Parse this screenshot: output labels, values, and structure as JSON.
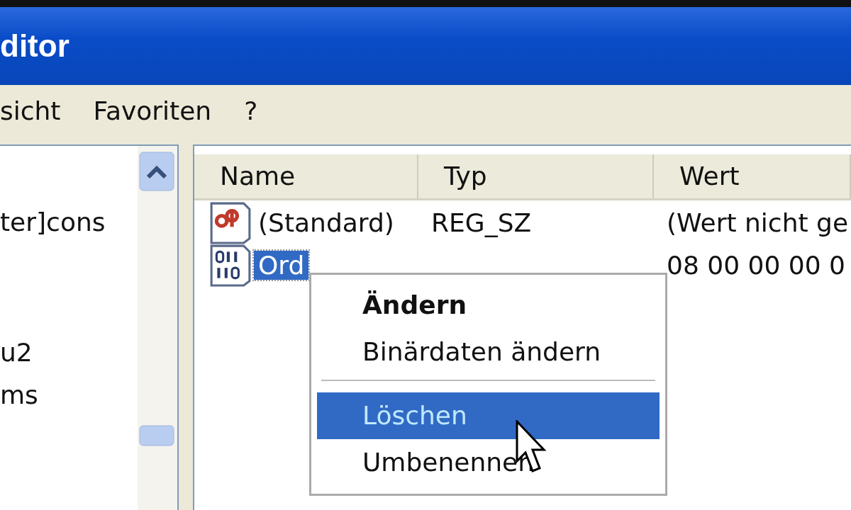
{
  "window": {
    "title": "ditor"
  },
  "menu_bar": [
    {
      "label": "sicht"
    },
    {
      "label": "Favoriten"
    },
    {
      "label": "?"
    }
  ],
  "tree": {
    "items": [
      {
        "label": "ter]cons"
      },
      {
        "label": "u2"
      },
      {
        "label": "ms"
      }
    ]
  },
  "table": {
    "columns": [
      "Name",
      "Typ",
      "Wert"
    ],
    "rows": [
      {
        "kind": "string",
        "name": "(Standard)",
        "type": "REG_SZ",
        "value": "(Wert nicht ge",
        "selected": false
      },
      {
        "kind": "binary",
        "name": "Ord",
        "value": "08 00 00 00 0",
        "selected": true
      }
    ]
  },
  "context_menu": {
    "items": [
      {
        "kind": "item",
        "label": "Ändern",
        "default": true,
        "selected": false
      },
      {
        "kind": "item",
        "label": "Binärdaten ändern",
        "default": false,
        "selected": false
      },
      {
        "kind": "separator"
      },
      {
        "kind": "item",
        "label": "Löschen",
        "default": false,
        "selected": true
      },
      {
        "kind": "item",
        "label": "Umbenennen",
        "default": false,
        "selected": false
      }
    ]
  }
}
